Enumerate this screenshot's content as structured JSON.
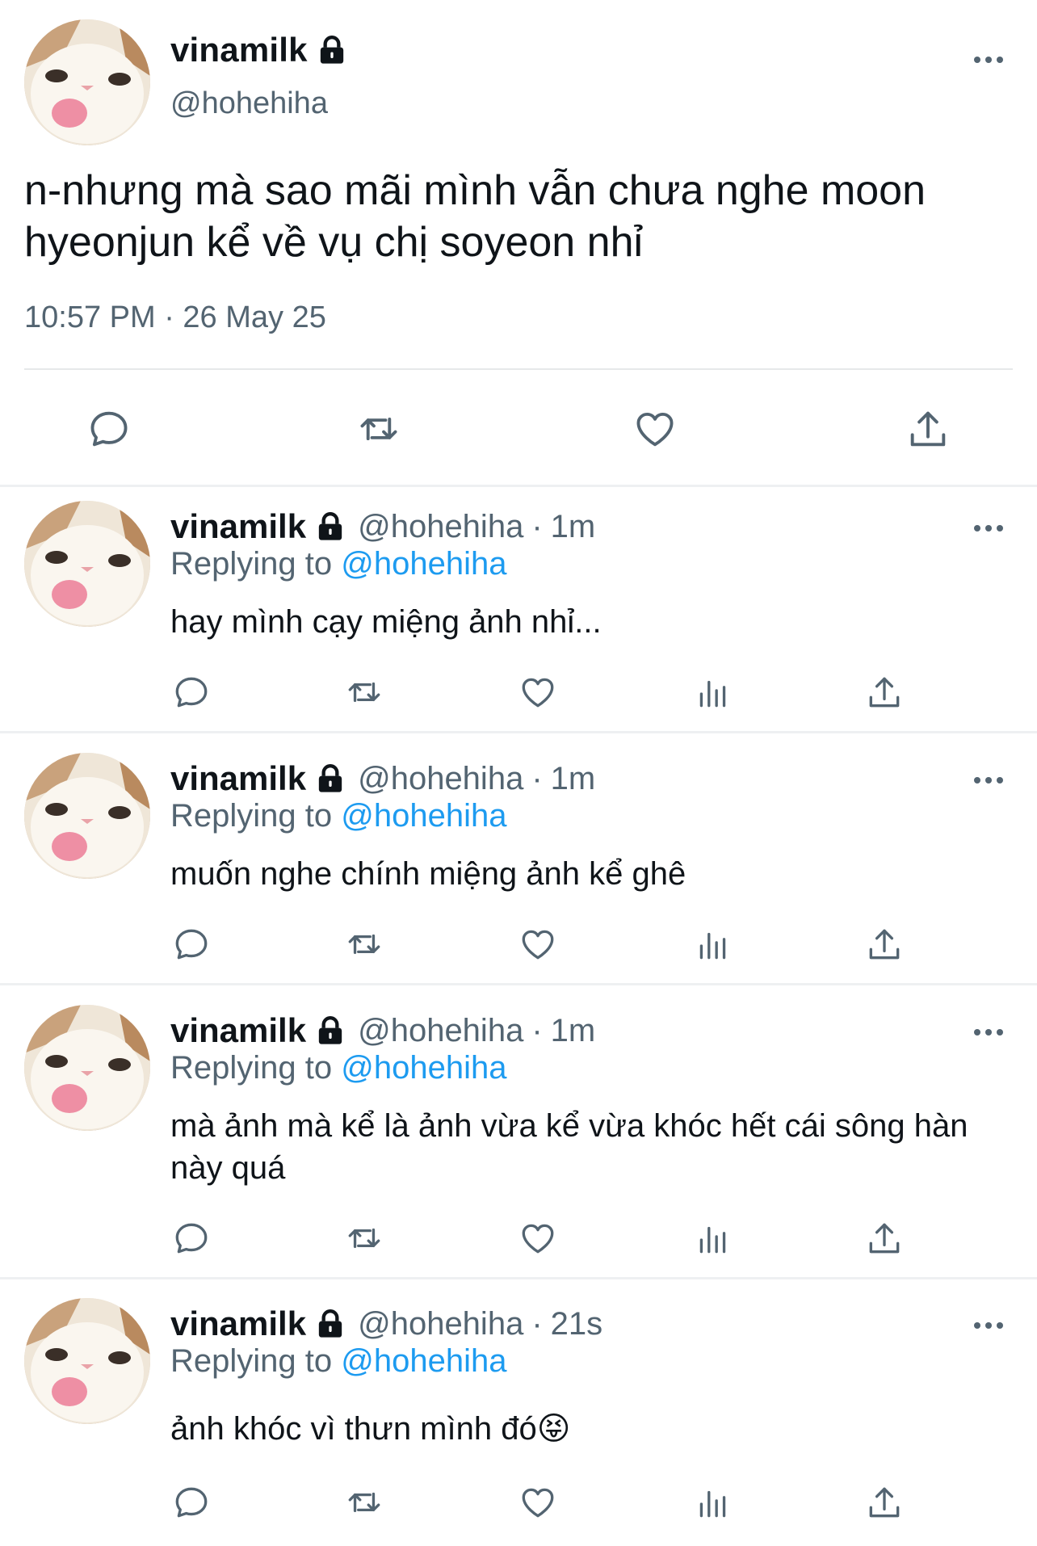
{
  "main_tweet": {
    "display_name": "vinamilk",
    "handle": "@hohehiha",
    "text": "n-nhưng mà sao mãi mình vẫn chưa nghe moon hyeonjun kể về vụ chị soyeon nhỉ",
    "timestamp": "10:57 PM · 26 May 25",
    "actions": [
      "reply-icon",
      "retweet-icon",
      "like-icon",
      "share-icon"
    ]
  },
  "replies": [
    {
      "display_name": "vinamilk",
      "handle": "@hohehiha",
      "separator": "·",
      "time": "1m",
      "replying_prefix": "Replying to",
      "replying_to": "@hohehiha",
      "text": "hay mình cạy miệng ảnh nhỉ..."
    },
    {
      "display_name": "vinamilk",
      "handle": "@hohehiha",
      "separator": "·",
      "time": "1m",
      "replying_prefix": "Replying to",
      "replying_to": "@hohehiha",
      "text": "muốn nghe chính miệng ảnh kể ghê"
    },
    {
      "display_name": "vinamilk",
      "handle": "@hohehiha",
      "separator": "·",
      "time": "1m",
      "replying_prefix": "Replying to",
      "replying_to": "@hohehiha",
      "text": "mà ảnh mà kể là ảnh vừa kể vừa khóc hết cái sông hàn này quá"
    },
    {
      "display_name": "vinamilk",
      "handle": "@hohehiha",
      "separator": "·",
      "time": "21s",
      "replying_prefix": "Replying to",
      "replying_to": "@hohehiha",
      "text": "ảnh khóc vì thưn mình đó😝"
    }
  ],
  "colors": {
    "text_primary": "#0f1419",
    "text_secondary": "#536471",
    "mention": "#1d9bf0",
    "divider": "#eef0f2"
  },
  "icons": {
    "protected": "lock-icon",
    "more": "more-options-icon",
    "reply_actions": [
      "reply-icon",
      "retweet-icon",
      "like-icon",
      "views-icon",
      "share-icon"
    ]
  }
}
